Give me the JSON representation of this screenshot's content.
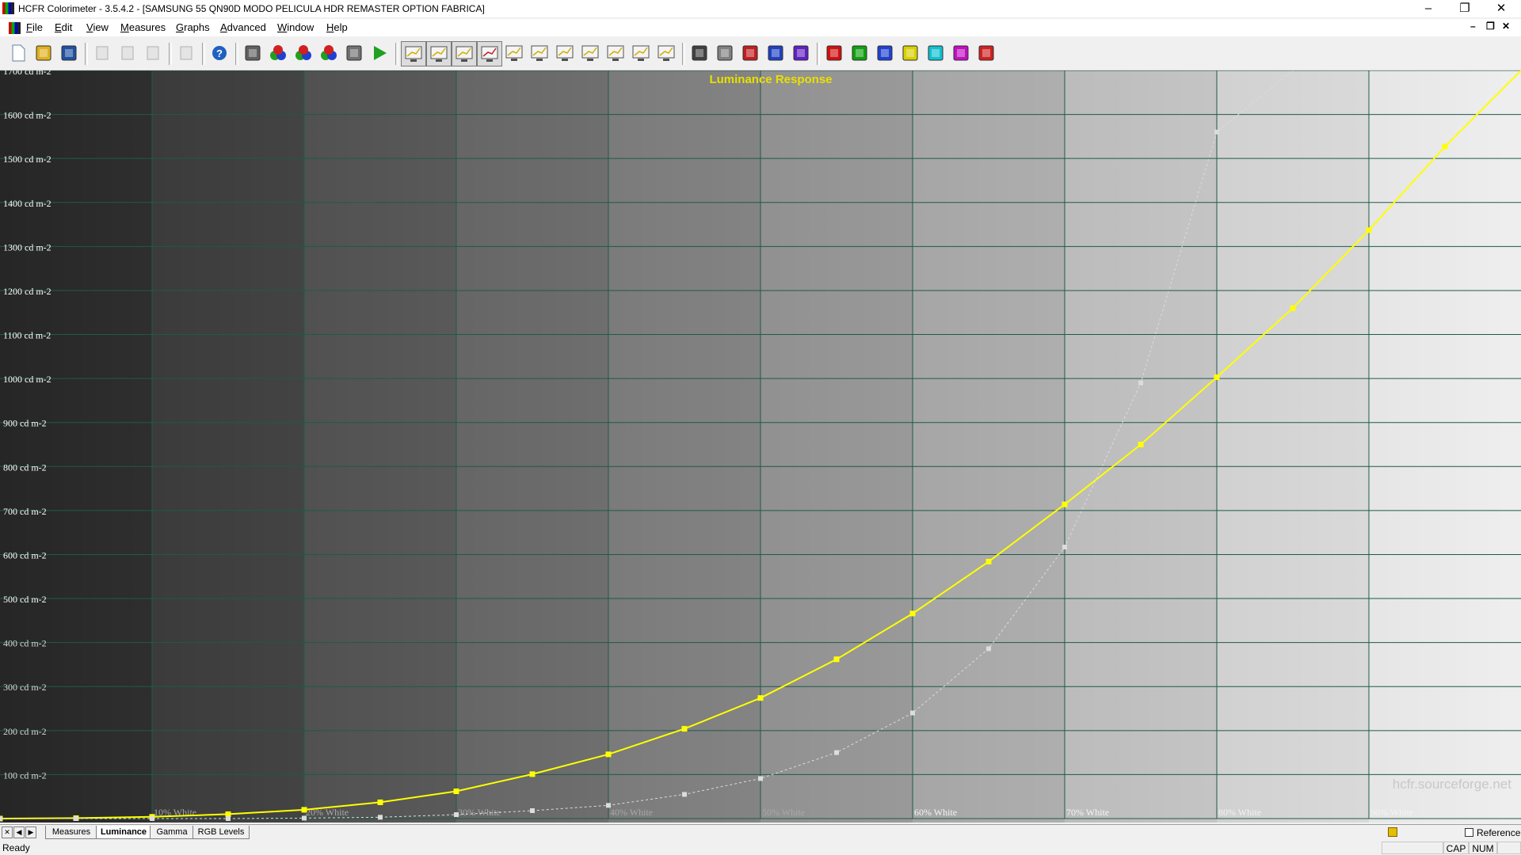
{
  "window": {
    "title": "HCFR Colorimeter - 3.5.4.2 - [SAMSUNG 55 QN90D MODO PELICULA HDR REMASTER OPTION FABRICA]",
    "minimize": "–",
    "maximize": "❐",
    "close": "✕"
  },
  "menu": [
    "File",
    "Edit",
    "View",
    "Measures",
    "Graphs",
    "Advanced",
    "Window",
    "Help"
  ],
  "mdi_controls": {
    "minimize": "–",
    "restore": "❐",
    "close": "✕"
  },
  "toolbar": {
    "groups": [
      [
        "new-icon",
        "open-icon",
        "save-icon"
      ],
      [
        "cut-icon",
        "copy-icon",
        "paste-icon"
      ],
      [
        "print-icon"
      ],
      [
        "help-icon"
      ],
      [
        "sensor-icon",
        "rgb-primaries-icon",
        "secondaries-icon",
        "color-wheel-icon",
        "camera-icon",
        "play-icon"
      ],
      [
        "view-measures-icon",
        "view-luminance-icon",
        "view-gamma-icon",
        "view-rgb-levels-icon",
        "view-saturation-icon",
        "view-cie-icon",
        "view-colortemp-icon",
        "view-delta-e-icon",
        "view-near-black-icon",
        "view-near-white-icon",
        "view-free-icon"
      ],
      [
        "grayscale-measure-icon",
        "grayscale-scale-icon",
        "primaries-measure-icon",
        "secondaries-measure-icon",
        "contrast-icon"
      ],
      [
        "red-sat-icon",
        "green-sat-icon",
        "blue-sat-icon",
        "yellow-sat-icon",
        "cyan-sat-icon",
        "magenta-sat-icon",
        "all-sat-icon"
      ]
    ],
    "pressed": [
      "view-measures-icon",
      "view-luminance-icon",
      "view-gamma-icon",
      "view-rgb-levels-icon"
    ]
  },
  "chart_data": {
    "type": "line",
    "title": "Luminance Response",
    "watermark": "hcfr.sourceforge.net",
    "ylabel_unit": "cd m-2",
    "ylim": [
      0,
      1700
    ],
    "yticks": [
      100,
      200,
      300,
      400,
      500,
      600,
      700,
      800,
      900,
      1000,
      1100,
      1200,
      1300,
      1400,
      1500,
      1600,
      1700
    ],
    "xlim": [
      0,
      100
    ],
    "xtick_labels": [
      "10% White",
      "20% White",
      "30% White",
      "40% White",
      "50% White",
      "60% White",
      "70% White",
      "80% White",
      "90% White"
    ],
    "xtick_values": [
      10,
      20,
      30,
      40,
      50,
      60,
      70,
      80,
      90
    ],
    "grid": true,
    "background": "grayscale-gradient",
    "series": [
      {
        "color": "#ffff00",
        "style": "solid",
        "x": [
          0,
          5,
          10,
          15,
          20,
          25,
          30,
          35,
          40,
          45,
          50,
          55,
          60,
          65,
          70,
          75,
          80,
          85,
          90,
          95,
          100
        ],
        "values": [
          0,
          1,
          4,
          10,
          20,
          37,
          62,
          101,
          146,
          204,
          274,
          362,
          466,
          584,
          714,
          850,
          1003,
          1160,
          1337,
          1527,
          1700
        ]
      },
      {
        "color": "#dcdcdc",
        "style": "dashed",
        "x": [
          0,
          5,
          10,
          15,
          20,
          25,
          30,
          35,
          40,
          45,
          50,
          55,
          60,
          65,
          70,
          75,
          80,
          85
        ],
        "values": [
          0,
          0,
          0,
          0,
          1,
          3,
          9,
          18,
          30,
          55,
          91,
          150,
          240,
          386,
          617,
          990,
          1560,
          1700
        ]
      }
    ]
  },
  "tabs": [
    "Measures",
    "Luminance",
    "Gamma",
    "RGB Levels"
  ],
  "active_tab": "Luminance",
  "tab_nav": [
    "✕",
    "◀",
    "▶"
  ],
  "reference_label": "Reference",
  "status": {
    "text": "Ready",
    "cap": "CAP",
    "num": "NUM"
  }
}
